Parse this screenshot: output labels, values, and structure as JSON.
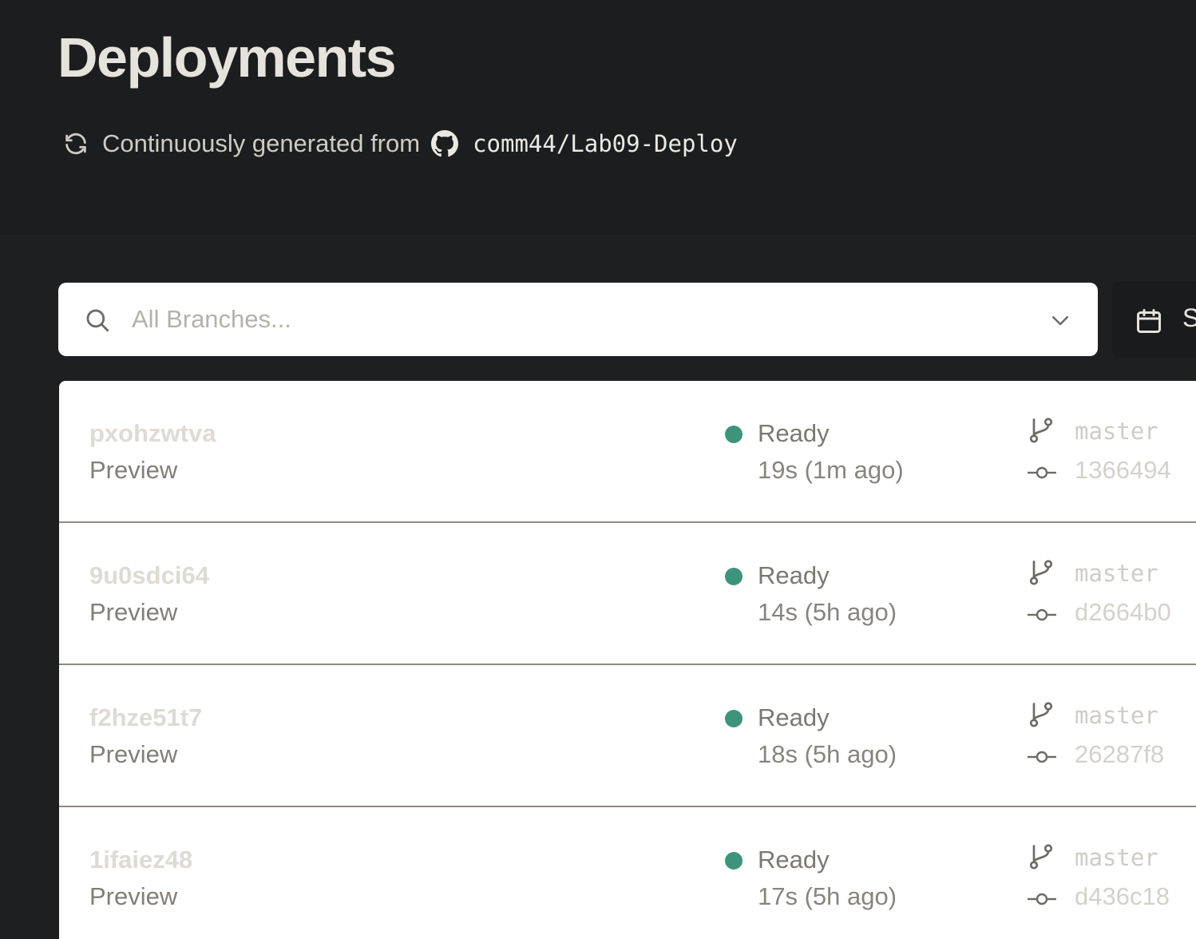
{
  "header": {
    "title": "Deployments",
    "subtitle_text": "Continuously generated from",
    "repo": "comm44/Lab09-Deploy"
  },
  "search": {
    "placeholder": "All Branches..."
  },
  "date_filter": {
    "label": "S"
  },
  "deployments": [
    {
      "id": "pxohzwtva",
      "environment": "Preview",
      "status": "Ready",
      "duration": "19s (1m ago)",
      "branch": "master",
      "commit": "1366494"
    },
    {
      "id": "9u0sdci64",
      "environment": "Preview",
      "status": "Ready",
      "duration": "14s (5h ago)",
      "branch": "master",
      "commit": "d2664b0"
    },
    {
      "id": "f2hze51t7",
      "environment": "Preview",
      "status": "Ready",
      "duration": "18s (5h ago)",
      "branch": "master",
      "commit": "26287f8"
    },
    {
      "id": "1ifaiez48",
      "environment": "Preview",
      "status": "Ready",
      "duration": "17s (5h ago)",
      "branch": "master",
      "commit": "d436c18"
    }
  ],
  "colors": {
    "status_ready": "#3e947a",
    "background": "#1c1d1f",
    "card": "#ffffff"
  },
  "icons": {
    "refresh": "refresh-icon",
    "github": "github-icon",
    "search": "search-icon",
    "dropdown": "chevron-down-icon",
    "calendar": "calendar-icon",
    "branch": "git-branch-icon",
    "commit": "git-commit-icon"
  }
}
